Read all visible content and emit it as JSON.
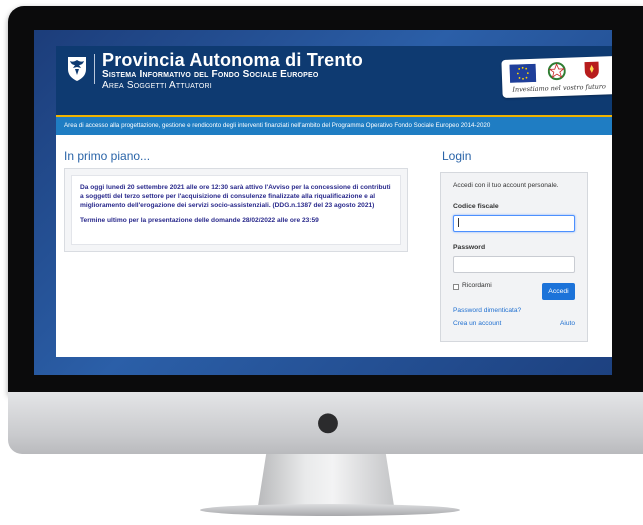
{
  "header": {
    "title": "Provincia Autonoma di Trento",
    "subtitle1": "Sistema Informativo del Fondo Sociale Europeo",
    "subtitle2": "Area Soggetti Attuatori",
    "banner_slogan": "Investiamo nel vostro futuro"
  },
  "info_bar": {
    "text": "Area di accesso alla progettazione, gestione e rendiconto degli interventi finanziati nell'ambito del Programma Operativo Fondo Sociale Europeo 2014-2020"
  },
  "highlights": {
    "title": "In primo piano...",
    "news_text": "Da oggi lunedì 20 settembre 2021 alle ore 12:30 sarà attivo l'Avviso per la concessione di contributi a soggetti del terzo settore per l'acquisizione di consulenze finalizzate alla riqualificazione e al miglioramento dell'erogazione dei servizi socio-assistenziali.  (DDG.n.1387 del 23 agosto 2021)",
    "deadline": "Termine ultimo per la presentazione delle domande 28/02/2022 alle ore 23:59"
  },
  "login": {
    "title": "Login",
    "intro": "Accedi con il tuo account personale.",
    "fiscal_code_label": "Codice fiscale",
    "fiscal_code_value": "",
    "password_label": "Password",
    "password_value": "",
    "remember_label": "Ricordami",
    "submit_label": "Accedi",
    "forgot_password": "Password dimenticata?",
    "create_account": "Crea un account",
    "help": "Aiuto"
  },
  "colors": {
    "header_bg": "#0e3a71",
    "info_bar_bg": "#1f7dc3",
    "accent_gold": "#f2b300",
    "button_bg": "#1c73d9",
    "news_text": "#2a2a8c"
  },
  "icons": {
    "coat": "trento-eagle-coat-of-arms-icon",
    "eu_flag": "eu-flag-icon",
    "italy": "italian-emblem-icon",
    "province": "trento-province-emblem-icon",
    "apple": "apple-logo-icon"
  }
}
